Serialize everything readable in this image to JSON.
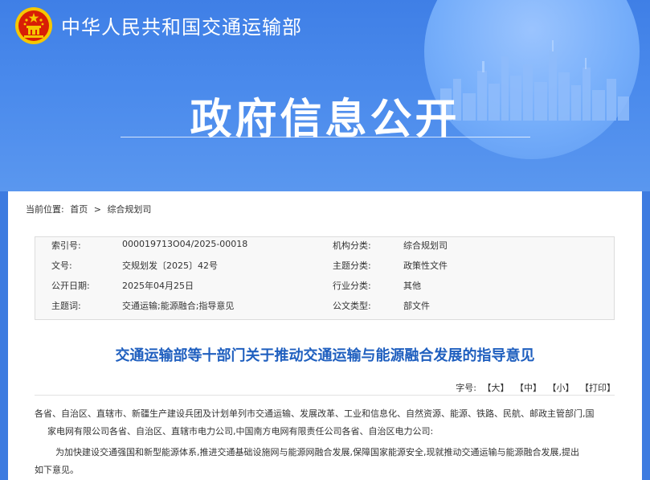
{
  "site": {
    "title": "中华人民共和国交通运输部"
  },
  "banner": {
    "heading": "政府信息公开"
  },
  "breadcrumb": {
    "label": "当前位置:",
    "home": "首页",
    "sep": ">",
    "current": "综合规划司"
  },
  "meta": [
    {
      "k1": "索引号:",
      "v1": "000019713O04/2025-00018",
      "k2": "机构分类:",
      "v2": "综合规划司"
    },
    {
      "k1": "文号:",
      "v1": "交规划发〔2025〕42号",
      "k2": "主题分类:",
      "v2": "政策性文件"
    },
    {
      "k1": "公开日期:",
      "v1": "2025年04月25日",
      "k2": "行业分类:",
      "v2": "其他"
    },
    {
      "k1": "主题词:",
      "v1": "交通运输;能源融合;指导意见",
      "k2": "公文类型:",
      "v2": "部文件"
    }
  ],
  "article": {
    "title": "交通运输部等十部门关于推动交通运输与能源融合发展的指导意见",
    "addressee_1": "各省、自治区、直辖市、新疆生产建设兵团及计划单列市交通运输、发展改革、工业和信息化、自然资源、能源、铁路、民航、邮政主管部门,国",
    "addressee_2": "家电网有限公司各省、自治区、直辖市电力公司,中国南方电网有限责任公司各省、自治区电力公司:",
    "intro_1": "为加快建设交通强国和新型能源体系,推进交通基础设施网与能源网融合发展,保障国家能源安全,现就推动交通运输与能源融合发展,提出",
    "intro_2": "如下意见。"
  },
  "fontsize": {
    "label": "字号:",
    "large": "【大】",
    "medium": "【中】",
    "small": "【小】",
    "print": "【打印】"
  },
  "colors": {
    "banner": "#3f7fe6",
    "title": "#1f5fbf",
    "emblem_red": "#d81e06",
    "emblem_gold": "#f6c700"
  }
}
